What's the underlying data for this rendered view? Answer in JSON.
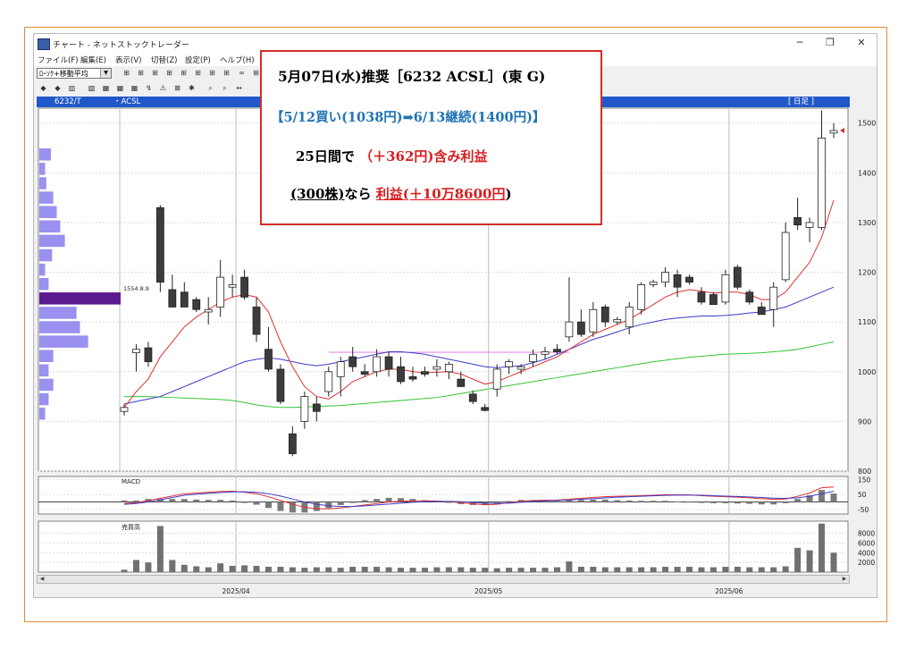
{
  "window": {
    "title": "チャート - ネットストックトレーダー",
    "controls": [
      "─",
      "❐",
      "✕"
    ]
  },
  "menu": [
    "ファイル(F)",
    "編集(E)",
    "表示(V)",
    "切替(Z)",
    "設定(P)",
    "ヘルプ(H)"
  ],
  "toolbar": {
    "indicator_select": "ﾛｰｿｸ+移動平均",
    "buttons_row1": [
      "⊞",
      "⊞",
      "⊞",
      "⊞",
      "⊞",
      "⊞",
      "⊞",
      "⊞",
      "∞",
      "⊞"
    ],
    "buttons_row2": [
      "◆",
      "◆",
      "▥",
      "▧",
      "▦",
      "▦",
      "▦",
      "↯",
      "⚠",
      "⊠",
      "✱",
      "⌕",
      "⌕",
      "↔"
    ]
  },
  "chart_header": {
    "code": "6232/T",
    "name": "・ACSL",
    "period": "[ 日足 ]"
  },
  "callout": {
    "line1": "5月07日(水)推奨［6232 ACSL］(東 G)",
    "line2": "【5/12買い(1038円)➡6/13継続(1400円)】",
    "line3_black": "25日間で",
    "line3_red": "（＋362円)含み利益",
    "line4_black_a": "(300株)",
    "line4_black_b": "なら",
    "line4_red": "利益(＋10万8600円",
    "line4_end": ")"
  },
  "colors": {
    "header_bar": "#2158c9",
    "callout_border": "#d52b2b",
    "callout_blue": "#1f73b5",
    "ma_short": "#e03030",
    "ma_mid": "#3b3bc8",
    "ma_long": "#35c435",
    "volume_profile": "#9a90ef",
    "volume_profile_peak": "#5c1a8f",
    "resistance_line": "#e58ae5",
    "candle_down": "#3c3c3c",
    "candle_up": "#ffffff"
  },
  "chart_data": {
    "type": "candlestick",
    "price_axis": {
      "ticks": [
        800,
        900,
        1000,
        1100,
        1200,
        1300,
        1400,
        1500
      ],
      "ylim": [
        800,
        1530
      ]
    },
    "x_axis": {
      "date_labels": [
        "2025/04",
        "2025/05",
        "2025/06"
      ],
      "label_at_index": [
        9,
        30,
        50
      ]
    },
    "volume_profile_peak_label": "1554.8.9",
    "resistance_level": 1039,
    "candles": [
      {
        "o": 920,
        "h": 935,
        "l": 912,
        "c": 928
      },
      {
        "o": 1038,
        "h": 1055,
        "l": 1000,
        "c": 1045
      },
      {
        "o": 1048,
        "h": 1060,
        "l": 1010,
        "c": 1020
      },
      {
        "o": 1330,
        "h": 1335,
        "l": 1160,
        "c": 1180
      },
      {
        "o": 1165,
        "h": 1195,
        "l": 1130,
        "c": 1130
      },
      {
        "o": 1160,
        "h": 1180,
        "l": 1130,
        "c": 1130
      },
      {
        "o": 1145,
        "h": 1150,
        "l": 1120,
        "c": 1125
      },
      {
        "o": 1120,
        "h": 1150,
        "l": 1095,
        "c": 1125
      },
      {
        "o": 1130,
        "h": 1225,
        "l": 1110,
        "c": 1190
      },
      {
        "o": 1170,
        "h": 1195,
        "l": 1150,
        "c": 1175
      },
      {
        "o": 1190,
        "h": 1205,
        "l": 1145,
        "c": 1150
      },
      {
        "o": 1130,
        "h": 1150,
        "l": 1060,
        "c": 1075
      },
      {
        "o": 1045,
        "h": 1090,
        "l": 1000,
        "c": 1005
      },
      {
        "o": 1005,
        "h": 1015,
        "l": 935,
        "c": 940
      },
      {
        "o": 875,
        "h": 890,
        "l": 830,
        "c": 835
      },
      {
        "o": 900,
        "h": 960,
        "l": 885,
        "c": 950
      },
      {
        "o": 935,
        "h": 950,
        "l": 900,
        "c": 920
      },
      {
        "o": 960,
        "h": 1010,
        "l": 950,
        "c": 1000
      },
      {
        "o": 990,
        "h": 1030,
        "l": 950,
        "c": 1020
      },
      {
        "o": 1030,
        "h": 1050,
        "l": 1000,
        "c": 1010
      },
      {
        "o": 1000,
        "h": 1015,
        "l": 990,
        "c": 995
      },
      {
        "o": 1000,
        "h": 1045,
        "l": 990,
        "c": 1030
      },
      {
        "o": 1030,
        "h": 1040,
        "l": 990,
        "c": 1005
      },
      {
        "o": 1010,
        "h": 1030,
        "l": 975,
        "c": 980
      },
      {
        "o": 990,
        "h": 1010,
        "l": 980,
        "c": 985
      },
      {
        "o": 1000,
        "h": 1010,
        "l": 990,
        "c": 995
      },
      {
        "o": 1005,
        "h": 1025,
        "l": 990,
        "c": 1010
      },
      {
        "o": 1000,
        "h": 1020,
        "l": 985,
        "c": 1015
      },
      {
        "o": 985,
        "h": 1000,
        "l": 970,
        "c": 970
      },
      {
        "o": 955,
        "h": 962,
        "l": 935,
        "c": 940
      },
      {
        "o": 928,
        "h": 935,
        "l": 920,
        "c": 922
      },
      {
        "o": 965,
        "h": 1015,
        "l": 950,
        "c": 1005
      },
      {
        "o": 1010,
        "h": 1025,
        "l": 995,
        "c": 1020
      },
      {
        "o": 1005,
        "h": 1015,
        "l": 995,
        "c": 1010
      },
      {
        "o": 1020,
        "h": 1045,
        "l": 1010,
        "c": 1035
      },
      {
        "o": 1035,
        "h": 1050,
        "l": 1025,
        "c": 1040
      },
      {
        "o": 1045,
        "h": 1055,
        "l": 1035,
        "c": 1040
      },
      {
        "o": 1070,
        "h": 1190,
        "l": 1060,
        "c": 1100
      },
      {
        "o": 1100,
        "h": 1125,
        "l": 1070,
        "c": 1075
      },
      {
        "o": 1080,
        "h": 1140,
        "l": 1070,
        "c": 1125
      },
      {
        "o": 1130,
        "h": 1135,
        "l": 1090,
        "c": 1100
      },
      {
        "o": 1100,
        "h": 1110,
        "l": 1095,
        "c": 1105
      },
      {
        "o": 1090,
        "h": 1140,
        "l": 1075,
        "c": 1130
      },
      {
        "o": 1125,
        "h": 1180,
        "l": 1115,
        "c": 1175
      },
      {
        "o": 1175,
        "h": 1185,
        "l": 1170,
        "c": 1180
      },
      {
        "o": 1180,
        "h": 1210,
        "l": 1170,
        "c": 1200
      },
      {
        "o": 1195,
        "h": 1205,
        "l": 1150,
        "c": 1170
      },
      {
        "o": 1190,
        "h": 1195,
        "l": 1175,
        "c": 1180
      },
      {
        "o": 1160,
        "h": 1170,
        "l": 1135,
        "c": 1140
      },
      {
        "o": 1155,
        "h": 1160,
        "l": 1135,
        "c": 1135
      },
      {
        "o": 1140,
        "h": 1205,
        "l": 1135,
        "c": 1195
      },
      {
        "o": 1210,
        "h": 1215,
        "l": 1165,
        "c": 1170
      },
      {
        "o": 1160,
        "h": 1165,
        "l": 1135,
        "c": 1140
      },
      {
        "o": 1130,
        "h": 1140,
        "l": 1115,
        "c": 1115
      },
      {
        "o": 1125,
        "h": 1180,
        "l": 1090,
        "c": 1170
      },
      {
        "o": 1185,
        "h": 1300,
        "l": 1180,
        "c": 1280
      },
      {
        "o": 1310,
        "h": 1350,
        "l": 1285,
        "c": 1295
      },
      {
        "o": 1290,
        "h": 1310,
        "l": 1260,
        "c": 1300
      },
      {
        "o": 1290,
        "h": 1525,
        "l": 1285,
        "c": 1470
      },
      {
        "o": 1480,
        "h": 1500,
        "l": 1470,
        "c": 1485
      }
    ],
    "ma_short": [
      928,
      960,
      985,
      1030,
      1060,
      1090,
      1110,
      1125,
      1140,
      1150,
      1155,
      1150,
      1120,
      1060,
      1010,
      970,
      950,
      945,
      960,
      980,
      990,
      1000,
      1005,
      1005,
      1000,
      998,
      999,
      1000,
      995,
      985,
      975,
      980,
      990,
      1000,
      1010,
      1020,
      1030,
      1045,
      1060,
      1075,
      1085,
      1095,
      1105,
      1120,
      1135,
      1150,
      1160,
      1165,
      1162,
      1158,
      1160,
      1160,
      1155,
      1145,
      1145,
      1160,
      1190,
      1220,
      1270,
      1345
    ],
    "ma_mid": [
      935,
      940,
      945,
      950,
      960,
      970,
      980,
      990,
      1000,
      1010,
      1020,
      1025,
      1028,
      1025,
      1020,
      1015,
      1012,
      1015,
      1020,
      1025,
      1030,
      1035,
      1040,
      1040,
      1038,
      1035,
      1030,
      1025,
      1020,
      1015,
      1010,
      1008,
      1010,
      1012,
      1018,
      1025,
      1035,
      1045,
      1055,
      1065,
      1072,
      1080,
      1088,
      1095,
      1100,
      1105,
      1108,
      1110,
      1112,
      1112,
      1113,
      1115,
      1118,
      1120,
      1125,
      1130,
      1140,
      1150,
      1160,
      1170
    ],
    "ma_long": [
      950,
      950,
      950,
      949,
      948,
      947,
      946,
      945,
      944,
      942,
      938,
      933,
      930,
      928,
      928,
      929,
      930,
      931,
      932,
      934,
      936,
      938,
      940,
      942,
      944,
      946,
      948,
      952,
      956,
      960,
      964,
      968,
      972,
      976,
      980,
      984,
      988,
      992,
      996,
      1000,
      1004,
      1008,
      1012,
      1016,
      1020,
      1023,
      1026,
      1029,
      1031,
      1033,
      1035,
      1036,
      1037,
      1038,
      1040,
      1042,
      1045,
      1050,
      1055,
      1060
    ],
    "volume_profile": [
      0.1,
      0.05,
      0.06,
      0.12,
      0.15,
      0.18,
      0.22,
      0.11,
      0.05,
      0.08,
      0.7,
      0.32,
      0.35,
      0.42,
      0.12,
      0.08,
      0.12,
      0.08,
      0.05
    ],
    "volume": [
      500,
      2500,
      2000,
      9500,
      2500,
      1500,
      1200,
      1000,
      1800,
      1300,
      1400,
      1300,
      1100,
      1100,
      1000,
      900,
      1000,
      1000,
      900,
      1100,
      1100,
      1100,
      1000,
      900,
      900,
      900,
      1000,
      1000,
      1000,
      900,
      900,
      800,
      900,
      900,
      900,
      900,
      1000,
      2200,
      1100,
      1100,
      1000,
      1000,
      1000,
      1000,
      1000,
      1100,
      1100,
      1100,
      1000,
      1000,
      1100,
      1100,
      1000,
      1000,
      1000,
      1200,
      5000,
      4500,
      10000,
      4000
    ],
    "volume_axis_ticks": [
      2000,
      4000,
      6000,
      8000
    ],
    "macd_axis_ticks": [
      -50,
      50,
      150
    ],
    "macd": [
      -10,
      -5,
      10,
      25,
      40,
      55,
      60,
      65,
      70,
      72,
      65,
      55,
      35,
      10,
      -15,
      -35,
      -45,
      -45,
      -40,
      -30,
      -20,
      -10,
      0,
      5,
      8,
      8,
      6,
      2,
      -5,
      -12,
      -18,
      -15,
      -5,
      5,
      10,
      12,
      13,
      18,
      25,
      30,
      35,
      38,
      40,
      42,
      45,
      48,
      48,
      47,
      42,
      38,
      35,
      32,
      28,
      22,
      18,
      20,
      38,
      60,
      95,
      100
    ],
    "macd_signal": [
      -15,
      -10,
      0,
      15,
      30,
      45,
      52,
      58,
      63,
      67,
      68,
      64,
      55,
      40,
      20,
      0,
      -15,
      -25,
      -30,
      -30,
      -26,
      -20,
      -14,
      -8,
      -2,
      2,
      4,
      4,
      2,
      -2,
      -8,
      -10,
      -8,
      -2,
      4,
      8,
      10,
      13,
      18,
      22,
      27,
      32,
      35,
      38,
      41,
      44,
      46,
      46,
      45,
      42,
      39,
      37,
      34,
      30,
      26,
      24,
      28,
      38,
      55,
      72
    ],
    "macd_labels": {
      "macd": "MACD",
      "volume": "売買高"
    }
  }
}
